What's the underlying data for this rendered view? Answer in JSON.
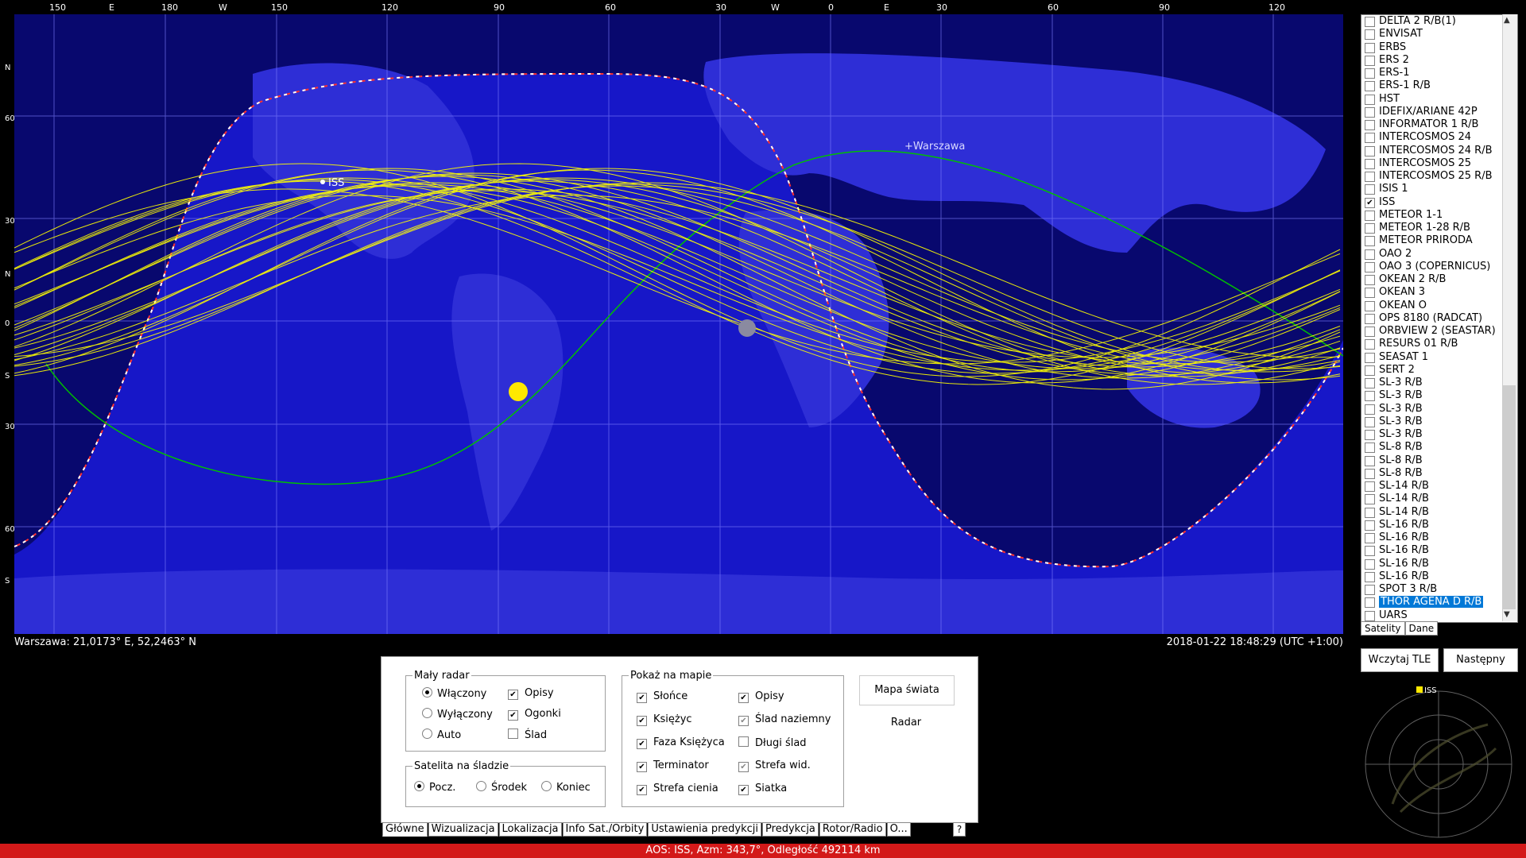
{
  "top_scale": {
    "labels": [
      "150",
      "E",
      "180",
      "W",
      "150",
      "120",
      "90",
      "60",
      "30",
      "W",
      "0",
      "E",
      "30",
      "60",
      "90",
      "120"
    ]
  },
  "lat_scale": {
    "labels": [
      "N",
      "60",
      "30",
      "N",
      "0",
      "S",
      "30",
      "60",
      "S"
    ]
  },
  "map": {
    "observer_label": "+Warszawa",
    "sat_label": "ISS",
    "location_text": "Warszawa: 21,0173° E, 52,2463° N",
    "datetime_text": "2018-01-22 18:48:29 (UTC +1:00)",
    "colors": {
      "day": "#1717c8",
      "night": "#08086e",
      "land_day": "#3030d8",
      "land_night": "#111190",
      "tracks": "#ffff00",
      "orbit": "#00c000",
      "terminator": "#ff2020",
      "grid": "#8080ff"
    }
  },
  "sat_list": {
    "items": [
      {
        "label": "DELTA 2 R/B(1)",
        "checked": false
      },
      {
        "label": "ENVISAT",
        "checked": false
      },
      {
        "label": "ERBS",
        "checked": false
      },
      {
        "label": "ERS 2",
        "checked": false
      },
      {
        "label": "ERS-1",
        "checked": false
      },
      {
        "label": "ERS-1 R/B",
        "checked": false
      },
      {
        "label": "HST",
        "checked": false
      },
      {
        "label": "IDEFIX/ARIANE 42P",
        "checked": false
      },
      {
        "label": "INFORMATOR 1 R/B",
        "checked": false
      },
      {
        "label": "INTERCOSMOS 24",
        "checked": false
      },
      {
        "label": "INTERCOSMOS 24 R/B",
        "checked": false
      },
      {
        "label": "INTERCOSMOS 25",
        "checked": false
      },
      {
        "label": "INTERCOSMOS 25 R/B",
        "checked": false
      },
      {
        "label": "ISIS 1",
        "checked": false
      },
      {
        "label": "ISS",
        "checked": true
      },
      {
        "label": "METEOR 1-1",
        "checked": false
      },
      {
        "label": "METEOR 1-28 R/B",
        "checked": false
      },
      {
        "label": "METEOR PRIRODA",
        "checked": false
      },
      {
        "label": "OAO 2",
        "checked": false
      },
      {
        "label": "OAO 3 (COPERNICUS)",
        "checked": false
      },
      {
        "label": "OKEAN 2 R/B",
        "checked": false
      },
      {
        "label": "OKEAN 3",
        "checked": false
      },
      {
        "label": "OKEAN O",
        "checked": false
      },
      {
        "label": "OPS 8180 (RADCAT)",
        "checked": false
      },
      {
        "label": "ORBVIEW 2 (SEASTAR)",
        "checked": false
      },
      {
        "label": "RESURS 01 R/B",
        "checked": false
      },
      {
        "label": "SEASAT 1",
        "checked": false
      },
      {
        "label": "SERT 2",
        "checked": false
      },
      {
        "label": "SL-3 R/B",
        "checked": false
      },
      {
        "label": "SL-3 R/B",
        "checked": false
      },
      {
        "label": "SL-3 R/B",
        "checked": false
      },
      {
        "label": "SL-3 R/B",
        "checked": false
      },
      {
        "label": "SL-3 R/B",
        "checked": false
      },
      {
        "label": "SL-8 R/B",
        "checked": false
      },
      {
        "label": "SL-8 R/B",
        "checked": false
      },
      {
        "label": "SL-8 R/B",
        "checked": false
      },
      {
        "label": "SL-14 R/B",
        "checked": false
      },
      {
        "label": "SL-14 R/B",
        "checked": false
      },
      {
        "label": "SL-14 R/B",
        "checked": false
      },
      {
        "label": "SL-16 R/B",
        "checked": false
      },
      {
        "label": "SL-16 R/B",
        "checked": false
      },
      {
        "label": "SL-16 R/B",
        "checked": false
      },
      {
        "label": "SL-16 R/B",
        "checked": false
      },
      {
        "label": "SL-16 R/B",
        "checked": false
      },
      {
        "label": "SPOT 3 R/B",
        "checked": false
      },
      {
        "label": "THOR AGENA D R/B",
        "checked": false,
        "selected": true
      },
      {
        "label": "UARS",
        "checked": false
      }
    ],
    "tabs": {
      "satelity": "Satelity",
      "dane": "Dane"
    }
  },
  "buttons": {
    "load_tle": "Wczytaj TLE",
    "next": "Następny"
  },
  "radar": {
    "sat_label": "ISS"
  },
  "panel": {
    "small_radar": {
      "title": "Mały radar",
      "on": "Włączony",
      "off": "Wyłączony",
      "auto": "Auto",
      "labels": "Opisy",
      "tails": "Ogonki",
      "trail": "Ślad"
    },
    "sat_on_track": {
      "title": "Satelita na śladzie",
      "start": "Pocz.",
      "middle": "Środek",
      "end": "Koniec"
    },
    "show_on_map": {
      "title": "Pokaż na mapie",
      "sun": "Słońce",
      "moon": "Księżyc",
      "moon_phase": "Faza Księżyca",
      "terminator": "Terminator",
      "shadow": "Strefa cienia",
      "labels": "Opisy",
      "ground_track": "Ślad naziemny",
      "long_track": "Długi ślad",
      "vis_zone": "Strefa wid.",
      "grid": "Siatka"
    },
    "world_map_button": "Mapa świata",
    "radar_button": "Radar",
    "tabs": [
      "Główne",
      "Wizualizacja",
      "Lokalizacja",
      "Info Sat./Orbity",
      "Ustawienia predykcji",
      "Predykcja",
      "Rotor/Radio",
      "O..."
    ],
    "help": "?"
  },
  "status": "AOS: ISS, Azm: 343,7°, Odległość 492114 km"
}
